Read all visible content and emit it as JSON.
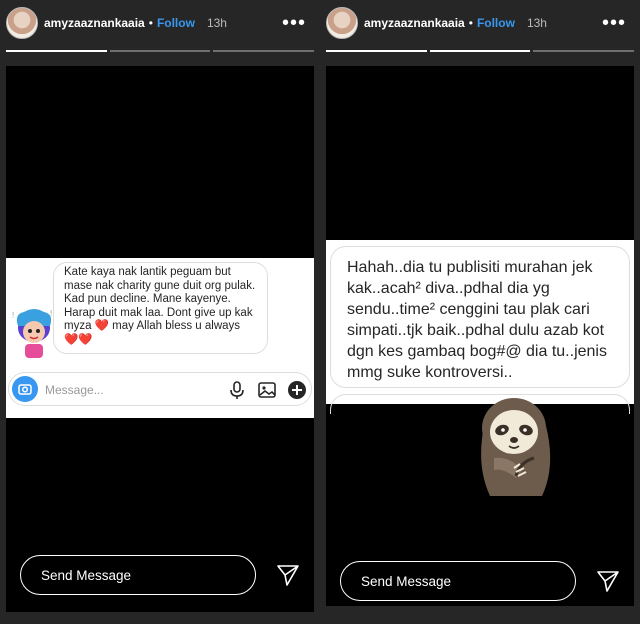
{
  "stories": [
    {
      "username": "amyzaaznankaaia",
      "separator": "•",
      "follow_label": "Follow",
      "time": "13h",
      "more_label": "•••",
      "progress": {
        "segments": 3,
        "current": 1
      },
      "screenshot": {
        "message": "Kate kaya nak lantik peguam but mase nak charity gune duit org pulak. Kad pun decline. Mane kayenye. Harap duit mak laa. Dont give up kak myza ❤️ may Allah bless u always ❤️❤️",
        "input_placeholder": "Message..."
      },
      "send_placeholder": "Send Message"
    },
    {
      "username": "amyzaaznankaaia",
      "separator": "•",
      "follow_label": "Follow",
      "time": "13h",
      "more_label": "•••",
      "progress": {
        "segments": 3,
        "current": 2
      },
      "screenshot": {
        "message": "Hahah..dia tu publisiti murahan jek kak..acah² diva..pdhal dia yg sendu..time² cenggini tau plak cari simpati..tjk baik..pdhal dulu azab kot dgn kes gambaq bog#@ dia tu..jenis mmg suke kontroversi.."
      },
      "send_placeholder": "Send Message"
    }
  ],
  "colors": {
    "accent": "#3897f0",
    "background": "#262626",
    "story_bg": "#000000"
  }
}
